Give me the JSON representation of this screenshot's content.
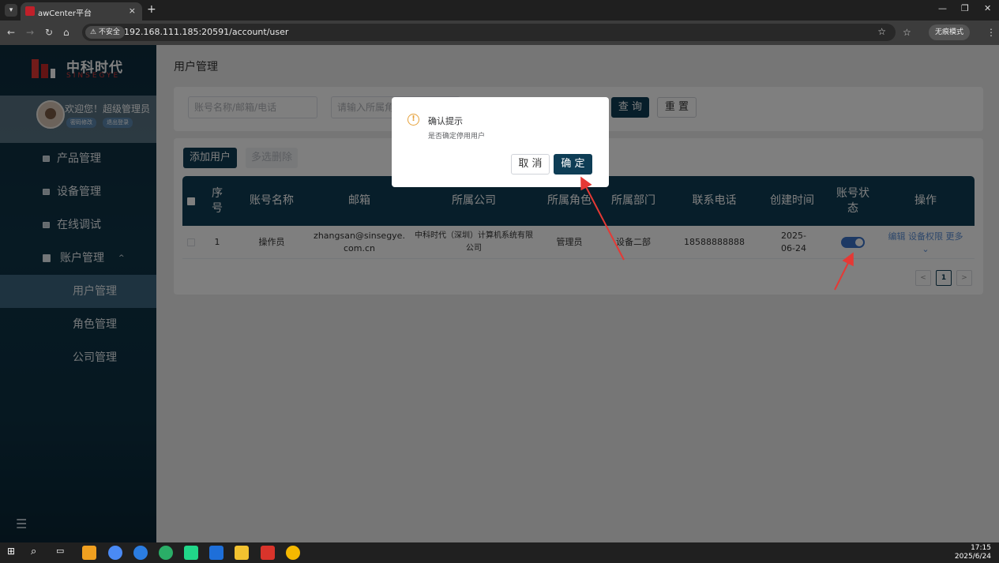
{
  "browser": {
    "tab_title": "awCenter平台",
    "tab_close": "×",
    "new_tab": "+",
    "insecure_label": "⚠ 不安全",
    "url": "192.168.111.185:20591/account/user",
    "incognito_label": "无痕模式"
  },
  "sidebar": {
    "logo_text": "中科时代",
    "logo_sub": "SINSEGYE",
    "welcome": "欢迎您！超级管理员",
    "btn_change_password": "密码修改",
    "btn_logout": "退出登录",
    "menu": [
      {
        "label": "产品管理"
      },
      {
        "label": "设备管理"
      },
      {
        "label": "在线调试"
      },
      {
        "label": "账户管理",
        "caret": "^"
      }
    ],
    "submenu": [
      {
        "label": "用户管理",
        "active": true
      },
      {
        "label": "角色管理"
      },
      {
        "label": "公司管理"
      }
    ]
  },
  "main": {
    "page_title": "用户管理",
    "search": {
      "account_placeholder": "账号名称/邮箱/电话",
      "role_placeholder": "请输入所属角",
      "query_button": "查 询",
      "reset_button": "重 置"
    },
    "toolbar": {
      "add_button": "添加用户",
      "batch_delete_button": "多选删除"
    },
    "table": {
      "columns": [
        "序号",
        "账号名称",
        "邮箱",
        "所属公司",
        "所属角色",
        "所属部门",
        "联系电话",
        "创建时间",
        "账号状态",
        "操作"
      ],
      "rows": [
        {
          "index": "1",
          "account": "操作员",
          "email": "zhangsan@sinsegye.com.cn",
          "company": "中科时代（深圳）计算机系统有限公司",
          "role": "管理员",
          "department": "设备二部",
          "phone": "18588888888",
          "created": "2025-06-24",
          "status_on": true,
          "ops": {
            "edit": "编辑",
            "perm": "设备权限",
            "more": "更多"
          }
        }
      ]
    },
    "pager": {
      "prev": "<",
      "page": "1",
      "next": ">"
    }
  },
  "modal": {
    "title": "确认提示",
    "message": "是否确定停用用户",
    "cancel": "取 消",
    "confirm": "确 定"
  },
  "taskbar": {
    "time": "17:15",
    "date": "2025/6/24"
  },
  "colors": {
    "primary": "#0e3d55",
    "sidebar_active": "#3c6680",
    "annotation_arrow": "#e53935",
    "warning": "#e6a23c",
    "switch_on": "#3a73c9"
  }
}
